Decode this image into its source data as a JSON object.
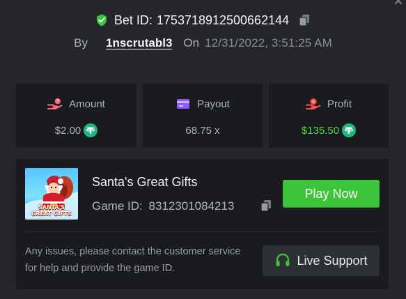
{
  "bet": {
    "label": "Bet ID:",
    "id": "1753718912500662144"
  },
  "meta": {
    "by_label": "By",
    "username": "1nscrutabl3",
    "on_label": "On",
    "datetime": "12/31/2022, 3:51:25 AM"
  },
  "stats": {
    "amount": {
      "label": "Amount",
      "value": "$2.00",
      "icon": "coins-hand-icon"
    },
    "payout": {
      "label": "Payout",
      "value": "68.75 x",
      "icon": "credit-card-icon"
    },
    "profit": {
      "label": "Profit",
      "value": "$135.50",
      "icon": "money-hand-icon"
    }
  },
  "game": {
    "name": "Santa's Great Gifts",
    "id_label": "Game ID:",
    "id": "8312301084213",
    "thumbnail_text_1": "SANTA'S",
    "thumbnail_text_2": "GREAT GIFTS",
    "play_label": "Play Now"
  },
  "support": {
    "notice": "Any issues, please contact the customer service for help and provide the game ID.",
    "button_label": "Live Support"
  },
  "colors": {
    "background": "#24262b",
    "card": "#191b1f",
    "green": "#3cc43b",
    "profit_green": "#52d94a",
    "tether": "#1fb77d",
    "amount_icon": "#ff6b7f",
    "payout_icon": "#8c5cff",
    "profit_icon": "#ff4c4c"
  }
}
